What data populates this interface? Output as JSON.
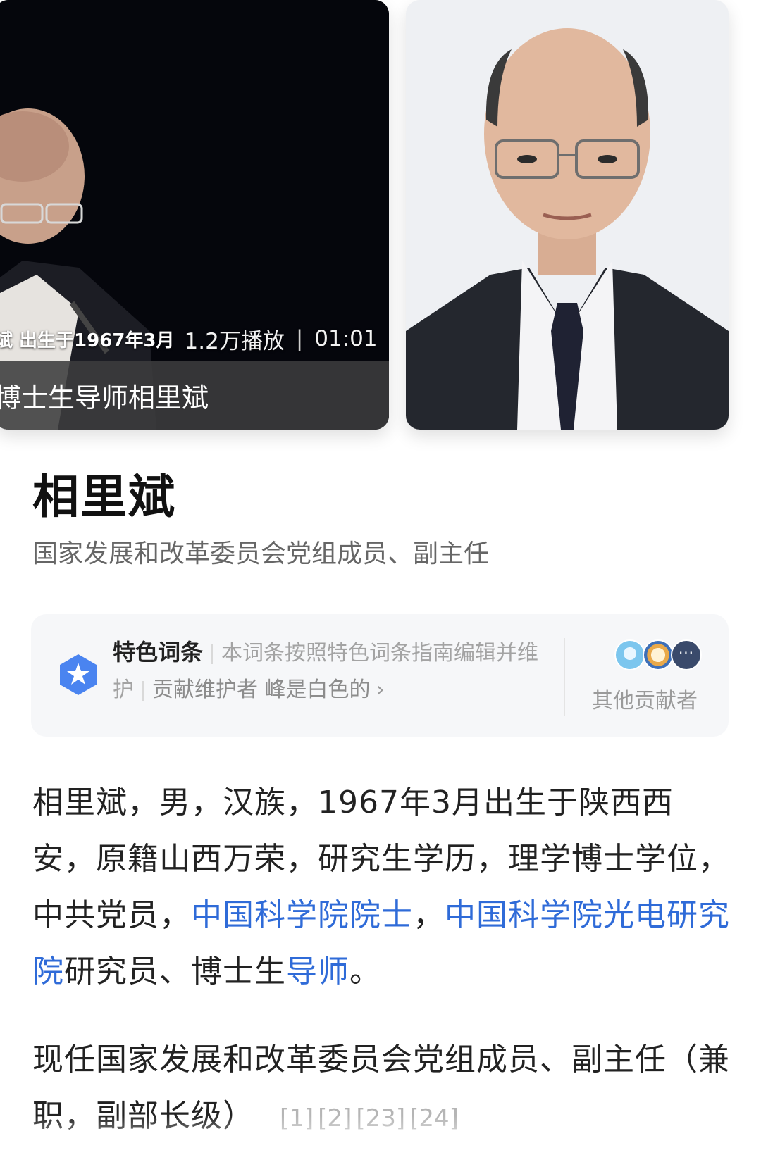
{
  "media": {
    "video": {
      "burnin_text": "斌 出生于1967年3月",
      "play_count": "1.2万播放",
      "separator": "|",
      "duration": "01:01",
      "caption": "博士生导师相里斌"
    },
    "photo": {
      "alt": "portrait-photo"
    }
  },
  "header": {
    "title": "相里斌",
    "subtitle": "国家发展和改革委员会党组成员、副主任"
  },
  "feature": {
    "label": "特色词条",
    "description": "本词条按照特色词条指南编辑并维护",
    "contributor_prefix": "贡献维护者",
    "contributor_name": "峰是白色的",
    "chevron": "›",
    "other_contributors": "其他贡献者",
    "more": "···"
  },
  "body": {
    "para1": {
      "text1": "相里斌，男，汉族，1967年3月出生于陕西西安，原籍山西万荣，研究生学历，理学博士学位，中共党员，",
      "link1": "中国科学院院士",
      "text2": "，",
      "link2": "中国科学院光电研究院",
      "text3": "研究员、博士生",
      "link3": "导师",
      "text4": "。"
    },
    "para2": {
      "text": "现任国家发展和改革委员会党组成员、副主任（兼职，副部长级）",
      "refs": [
        "[1]",
        "[2]",
        "[23]",
        "[24]"
      ]
    }
  },
  "colors": {
    "link": "#2f6bd8",
    "badge_blue": "#4a84f0",
    "caption_bar": "#3c3c3e"
  }
}
